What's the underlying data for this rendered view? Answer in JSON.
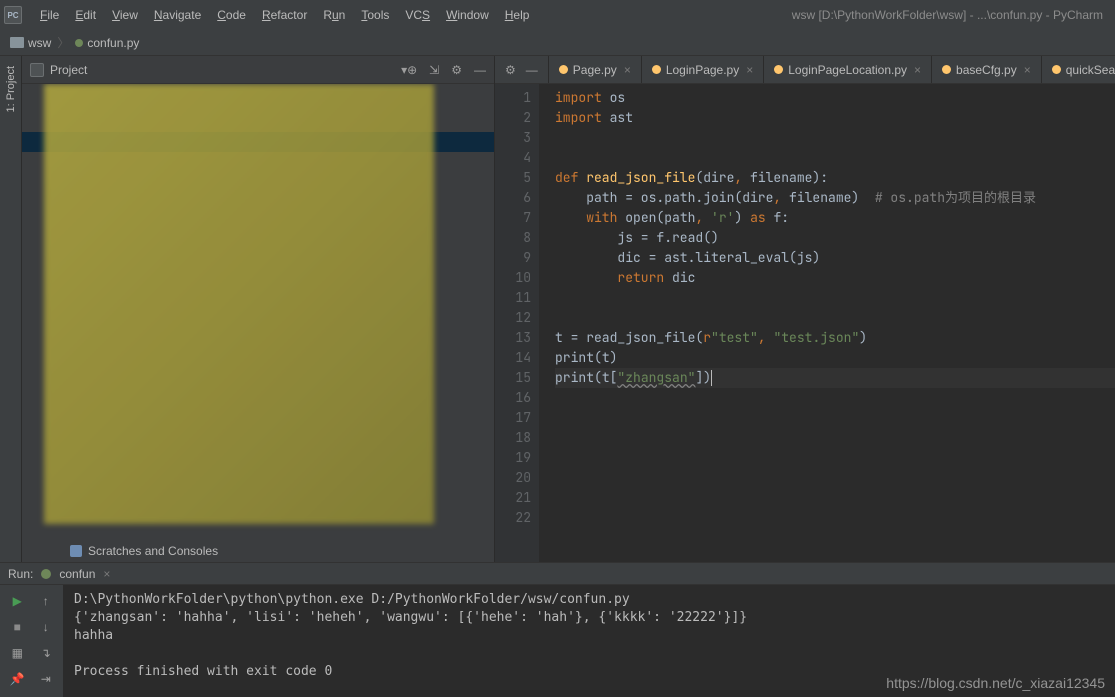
{
  "window_title": "wsw [D:\\PythonWorkFolder\\wsw] - ...\\confun.py - PyCharm",
  "menubar": [
    "File",
    "Edit",
    "View",
    "Navigate",
    "Code",
    "Refactor",
    "Run",
    "Tools",
    "VCS",
    "Window",
    "Help"
  ],
  "breadcrumb": {
    "root": "wsw",
    "file": "confun.py"
  },
  "project_panel": {
    "title": "Project",
    "scratches": "Scratches and Consoles"
  },
  "tabs": [
    {
      "label": "Page.py",
      "active": false
    },
    {
      "label": "LoginPage.py",
      "active": false
    },
    {
      "label": "LoginPageLocation.py",
      "active": false
    },
    {
      "label": "baseCfg.py",
      "active": false
    },
    {
      "label": "quickSearch.py",
      "active": false
    }
  ],
  "code_lines_count": 22,
  "code_comment": "# os.path为项目的根目录",
  "code": {
    "l1a": "import",
    "l1b": " os",
    "l2a": "import",
    "l2b": " ast",
    "l5a": "def ",
    "l5b": "read_json_file",
    "l5c": "(dire",
    "l5comma1": ", ",
    "l5d": "filename):",
    "l6a": "    path = os.path.join(dire",
    "l6b": ", ",
    "l6c": "filename)  ",
    "l7a": "    ",
    "l7b": "with ",
    "l7c": "open",
    "l7d": "(path",
    "l7e": ", ",
    "l7f": "'r'",
    "l7g": ") ",
    "l7h": "as ",
    "l7i": "f:",
    "l8": "        js = f.read()",
    "l9": "        dic = ast.literal_eval(js)",
    "l10a": "        ",
    "l10b": "return ",
    "l10c": "dic",
    "l13a": "t = read_json_file(",
    "l13b": "r",
    "l13c": "\"test\"",
    "l13d": ", ",
    "l13e": "\"test.json\"",
    "l13f": ")",
    "l14a": "print",
    "l14b": "(t)",
    "l15a": "print",
    "l15b": "(t[",
    "l15c": "\"zhangsan\"",
    "l15d": "])"
  },
  "run": {
    "label": "Run:",
    "config": "confun",
    "out1": "D:\\PythonWorkFolder\\python\\python.exe D:/PythonWorkFolder/wsw/confun.py",
    "out2": "{'zhangsan': 'hahha', 'lisi': 'heheh', 'wangwu': [{'hehe': 'hah'}, {'kkkk': '22222'}]}",
    "out3": "hahha",
    "out4": "",
    "out5": "Process finished with exit code 0"
  },
  "watermark": "https://blog.csdn.net/c_xiazai12345",
  "vtab": "1: Project"
}
